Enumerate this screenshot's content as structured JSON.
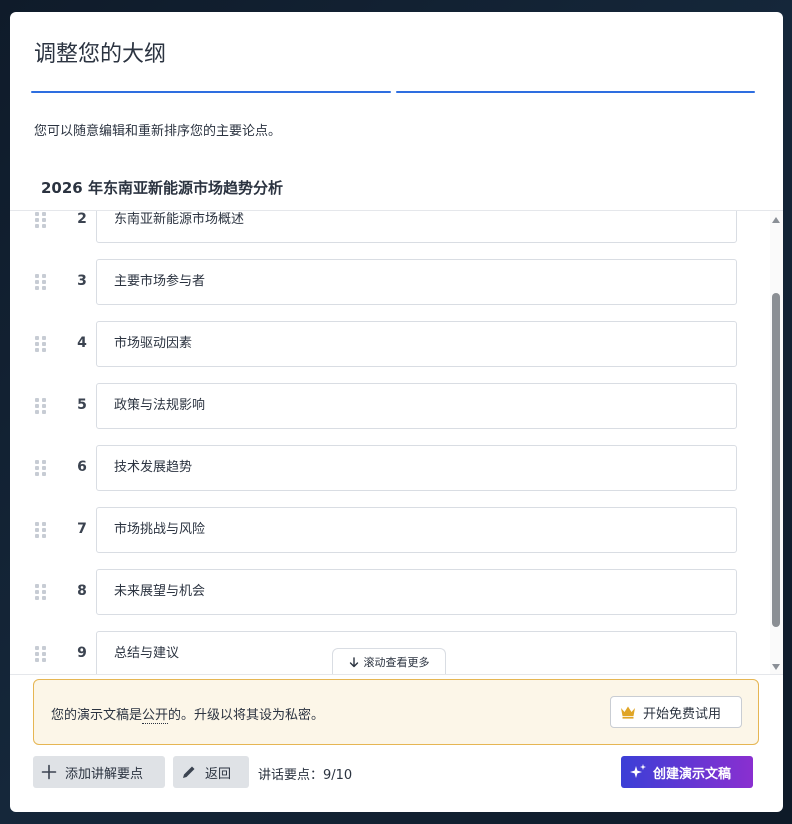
{
  "dialog": {
    "title": "调整您的大纲",
    "subtitle": "您可以随意编辑和重新排序您的主要论点。",
    "outline_title": "2026 年东南亚新能源市场趋势分析"
  },
  "outline_items": [
    {
      "num": "2",
      "text": "东南亚新能源市场概述"
    },
    {
      "num": "3",
      "text": "主要市场参与者"
    },
    {
      "num": "4",
      "text": "市场驱动因素"
    },
    {
      "num": "5",
      "text": "政策与法规影响"
    },
    {
      "num": "6",
      "text": "技术发展趋势"
    },
    {
      "num": "7",
      "text": "市场挑战与风险"
    },
    {
      "num": "8",
      "text": "未来展望与机会"
    },
    {
      "num": "9",
      "text": "总结与建议"
    }
  ],
  "scroll_more": "滚动查看更多",
  "notice": {
    "text_before": "您的演示文稿是",
    "text_public": "公开",
    "text_after": "的。升级以将其设为私密。",
    "trial_button": "开始免费试用"
  },
  "toolbar": {
    "add_button": "添加讲解要点",
    "back_button": "返回",
    "count": "讲话要点：9/10",
    "create_button": "创建演示文稿"
  },
  "colors": {
    "accent_blue": "#2e6ee0",
    "notice_bg": "#fcf6e8",
    "notice_border": "#e6b653",
    "create_gradient_start": "#3b3fd6",
    "create_gradient_end": "#8a2fd0",
    "crown": "#e0a526"
  },
  "icons": {
    "drag_handle": "drag-handle-icon",
    "arrow_down": "arrow-down-icon",
    "crown": "crown-icon",
    "plus": "plus-icon",
    "pencil": "pencil-icon",
    "sparkles": "sparkles-icon"
  }
}
